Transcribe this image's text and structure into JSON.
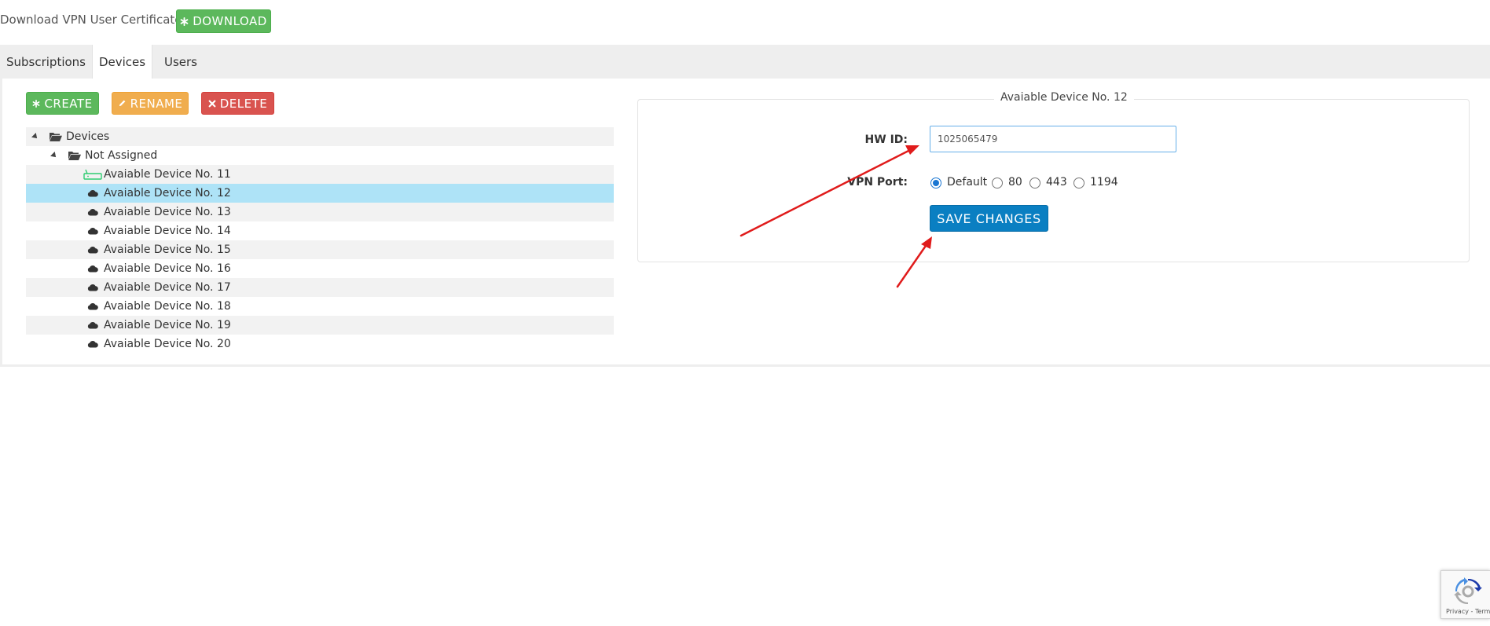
{
  "certificate": {
    "label": "Download VPN User Certificate:",
    "download_label": "DOWNLOAD"
  },
  "tabs": [
    {
      "label": "Subscriptions",
      "active": false
    },
    {
      "label": "Devices",
      "active": true
    },
    {
      "label": "Users",
      "active": false
    }
  ],
  "toolbar": {
    "create_label": "CREATE",
    "rename_label": "RENAME",
    "delete_label": "DELETE"
  },
  "tree": {
    "root": {
      "label": "Devices",
      "icon": "folder-open-icon"
    },
    "group": {
      "label": "Not Assigned",
      "icon": "folder-open-icon"
    },
    "items": [
      {
        "label": "Avaiable Device No. 11",
        "icon": "router-icon",
        "selected": false
      },
      {
        "label": "Avaiable Device No. 12",
        "icon": "cloud-icon",
        "selected": true
      },
      {
        "label": "Avaiable Device No. 13",
        "icon": "cloud-icon",
        "selected": false
      },
      {
        "label": "Avaiable Device No. 14",
        "icon": "cloud-icon",
        "selected": false
      },
      {
        "label": "Avaiable Device No. 15",
        "icon": "cloud-icon",
        "selected": false
      },
      {
        "label": "Avaiable Device No. 16",
        "icon": "cloud-icon",
        "selected": false
      },
      {
        "label": "Avaiable Device No. 17",
        "icon": "cloud-icon",
        "selected": false
      },
      {
        "label": "Avaiable Device No. 18",
        "icon": "cloud-icon",
        "selected": false
      },
      {
        "label": "Avaiable Device No. 19",
        "icon": "cloud-icon",
        "selected": false
      },
      {
        "label": "Avaiable Device No. 20",
        "icon": "cloud-icon",
        "selected": false
      }
    ]
  },
  "device_form": {
    "legend": "Avaiable Device No. 12",
    "hw_id_label": "HW ID:",
    "hw_id_value": "1025065479",
    "vpn_port_label": "VPN Port:",
    "vpn_port_options": [
      {
        "label": "Default",
        "checked": true
      },
      {
        "label": "80",
        "checked": false
      },
      {
        "label": "443",
        "checked": false
      },
      {
        "label": "1194",
        "checked": false
      }
    ],
    "save_label": "SAVE CHANGES"
  },
  "recaptcha": {
    "terms": "Privacy - Terms"
  },
  "colors": {
    "green": "#5cb85c",
    "orange": "#f0ad4e",
    "red": "#d9534f",
    "blue": "#0a7fc2",
    "selected_row": "#aee3f7",
    "annotation_arrow": "#e01b1b"
  }
}
